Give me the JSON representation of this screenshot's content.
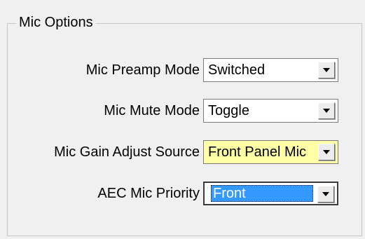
{
  "group": {
    "title": "Mic Options"
  },
  "rows": [
    {
      "label": "Mic Preamp Mode",
      "value": "Switched"
    },
    {
      "label": "Mic Mute Mode",
      "value": "Toggle"
    },
    {
      "label": "Mic Gain Adjust Source",
      "value": "Front Panel Mic"
    },
    {
      "label": "AEC Mic Priority",
      "value": "Front"
    }
  ],
  "icons": {
    "dropdown": "chevron-down-icon"
  },
  "colors": {
    "background": "#f0f0f0",
    "highlight_field": "#ffffa6",
    "selection": "#3399ff"
  }
}
